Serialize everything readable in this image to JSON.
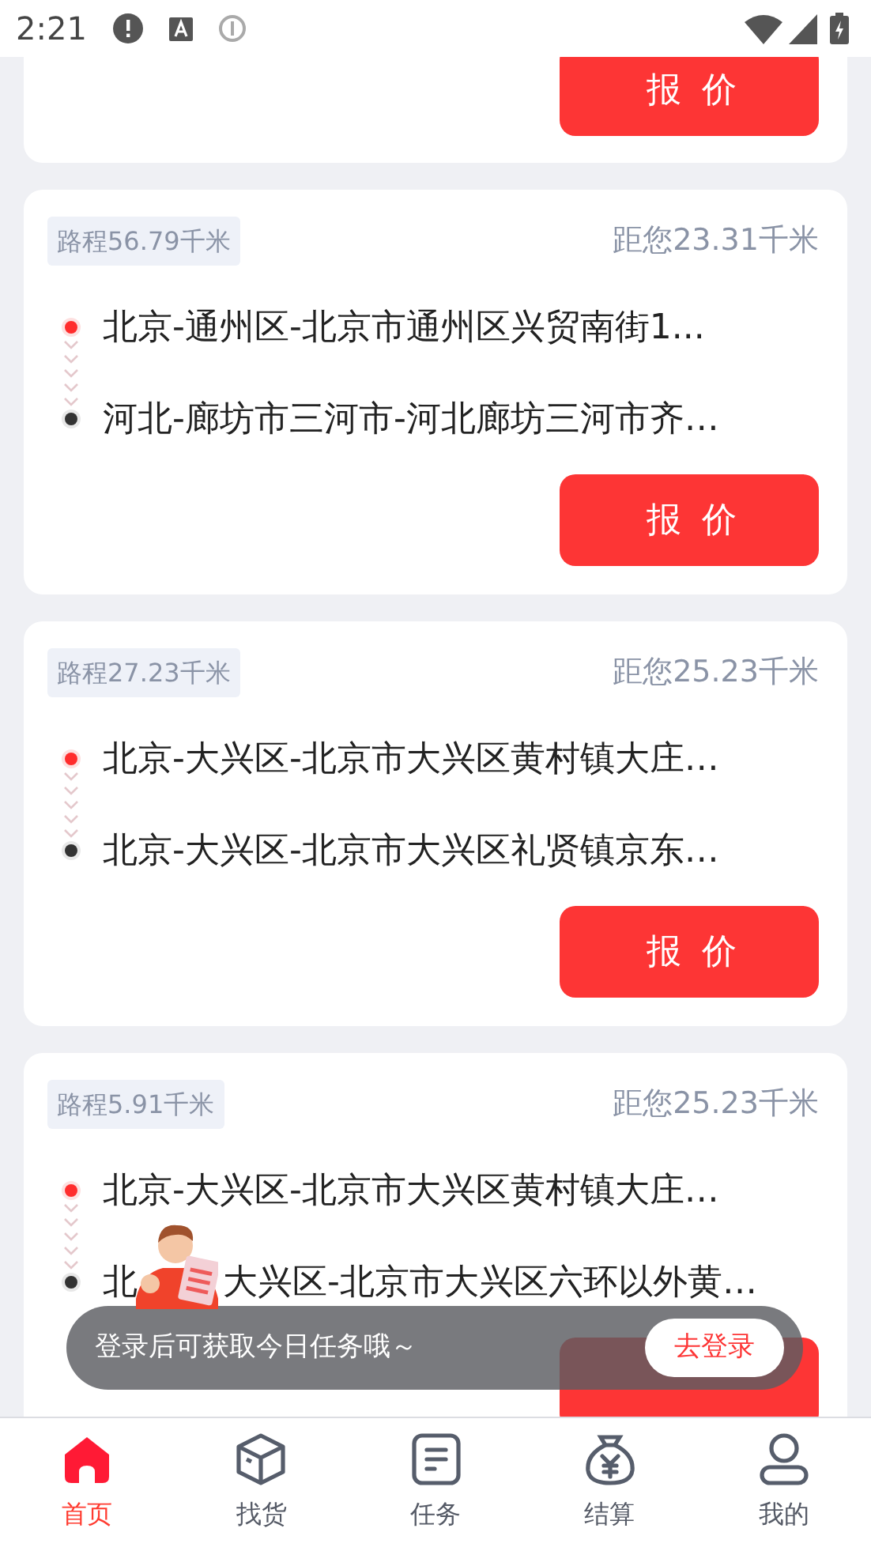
{
  "status_bar": {
    "time": "2:21"
  },
  "orders": [
    {
      "partial": true,
      "quote_button": "报价"
    },
    {
      "partial": false,
      "route_distance": "路程56.79千米",
      "distance_to_you": "距您23.31千米",
      "stops": [
        {
          "kind": "pickup",
          "address": "北京-通州区-北京市通州区兴贸南街1..."
        },
        {
          "kind": "dropoff",
          "address": "河北-廊坊市三河市-河北廊坊三河市齐…"
        }
      ],
      "quote_button": "报价"
    },
    {
      "partial": false,
      "route_distance": "路程27.23千米",
      "distance_to_you": "距您25.23千米",
      "stops": [
        {
          "kind": "pickup",
          "address": "北京-大兴区-北京市大兴区黄村镇大庄…"
        },
        {
          "kind": "dropoff",
          "address": "北京-大兴区-北京市大兴区礼贤镇京东…"
        }
      ],
      "quote_button": "报价"
    },
    {
      "partial": false,
      "route_distance": "路程5.91千米",
      "distance_to_you": "距您25.23千米",
      "stops": [
        {
          "kind": "pickup",
          "address": "北京-大兴区-北京市大兴区黄村镇大庄…"
        },
        {
          "kind": "dropoff",
          "address": "北",
          "address_after_figure": "大兴区-北京市大兴区六环以外黄…"
        }
      ],
      "quote_button_under_toast": true
    }
  ],
  "login_toast": {
    "message": "登录后可获取今日任务哦～",
    "button": "去登录"
  },
  "bottom_nav": [
    {
      "kind": "home",
      "label": "首页",
      "selected": true
    },
    {
      "kind": "box",
      "label": "找货",
      "selected": false
    },
    {
      "kind": "task",
      "label": "任务",
      "selected": false
    },
    {
      "kind": "settle",
      "label": "结算",
      "selected": false
    },
    {
      "kind": "profile",
      "label": "我的",
      "selected": false
    }
  ]
}
